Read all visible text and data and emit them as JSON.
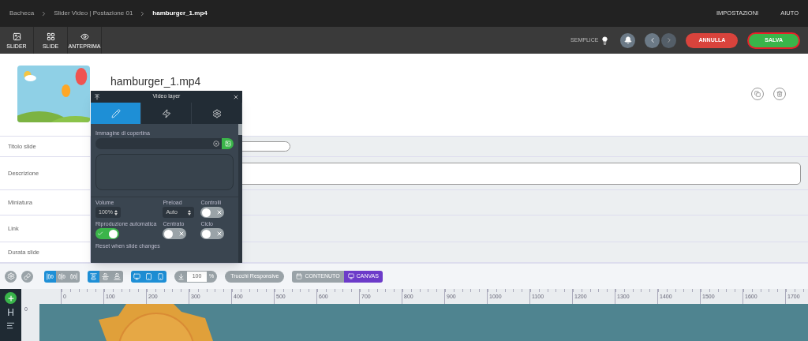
{
  "breadcrumb": [
    {
      "label": "Bacheca",
      "selected": false
    },
    {
      "label": "Slider Video | Postazione 01",
      "selected": false
    },
    {
      "label": "hamburger_1.mp4",
      "selected": true
    }
  ],
  "top_menu": [
    "IMPOSTAZIONI",
    "AIUTO"
  ],
  "toolbar": {
    "tools": [
      {
        "label": "SLIDER"
      },
      {
        "label": "SLIDE"
      },
      {
        "label": "ANTEPRIMA"
      }
    ],
    "mode_label": "SEMPLICE",
    "cancel": "ANNULLA",
    "save": "SALVA"
  },
  "slide": {
    "title": "hamburger_1.mp4"
  },
  "form_rows": [
    {
      "label": "Titolo slide",
      "kind": "input"
    },
    {
      "label": "Descrizione",
      "kind": "textarea"
    },
    {
      "label": "Miniatura",
      "kind": "blank"
    },
    {
      "label": "Link",
      "kind": "blank"
    },
    {
      "label": "Durata slide",
      "kind": "blank"
    }
  ],
  "video_layer": {
    "title": "Video layer",
    "tabs": [
      {
        "selected": true
      },
      {
        "selected": false
      },
      {
        "selected": false
      }
    ],
    "cover_label": "Immagine di copertina",
    "fields": [
      {
        "label": "Volume",
        "kind": "select",
        "value": "100%"
      },
      {
        "label": "Preload",
        "kind": "select",
        "value": "Auto"
      },
      {
        "label": "Controlli",
        "kind": "toggle",
        "on": false
      },
      {
        "label": "Riproduzione automatica",
        "kind": "toggle",
        "on": true
      },
      {
        "label": "Centrato",
        "kind": "toggle",
        "on": false
      },
      {
        "label": "Ciclo",
        "kind": "toggle",
        "on": false
      }
    ],
    "footer_label": "Reset when slide changes"
  },
  "editor_toolbar": {
    "align_h": [
      {
        "selected": true
      },
      {
        "selected": false
      },
      {
        "selected": false
      }
    ],
    "align_v": [
      {
        "selected": true
      },
      {
        "selected": false
      },
      {
        "selected": false
      }
    ],
    "scale": {
      "value": "100",
      "unit": "%"
    },
    "responsive": "Trucchi Responsive",
    "view_tabs": [
      {
        "label": "CONTENUTO",
        "selected": false
      },
      {
        "label": "CANVAS",
        "selected": true
      }
    ]
  },
  "side_tools": [
    {
      "kind": "add"
    },
    {
      "kind": "heading",
      "label": "H"
    },
    {
      "kind": "text"
    }
  ],
  "ruler": {
    "labels": [
      "0",
      "100",
      "200",
      "300",
      "400",
      "500",
      "600",
      "700",
      "800",
      "900",
      "1000",
      "1100",
      "1200",
      "1300",
      "1400",
      "1500",
      "1600",
      "1700"
    ],
    "vertical_labels": [
      "0"
    ]
  }
}
